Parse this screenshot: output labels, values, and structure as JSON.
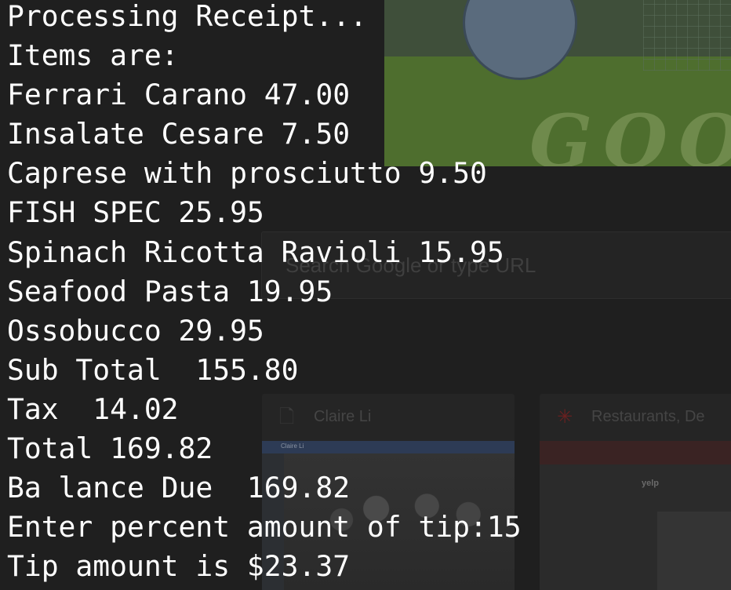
{
  "terminal": {
    "lines": [
      "Processing Receipt...",
      "Items are:",
      "Ferrari Carano 47.00",
      "Insalate Cesare 7.50",
      "Caprese with prosciutto 9.50",
      "FISH SPEC 25.95",
      "Spinach Ricotta Ravioli 15.95",
      "Seafood Pasta 19.95",
      "Ossobucco 29.95",
      "Sub Total  155.80",
      "Tax  14.02",
      "Total 169.82",
      "Ba lance Due  169.82",
      "Enter percent amount of tip:15",
      "Tip amount is $23.37"
    ]
  },
  "background_page": {
    "search": {
      "placeholder": "Search Google or type URL"
    },
    "tiles": [
      {
        "title": "Claire Li",
        "icon": "page-icon"
      },
      {
        "title": "Restaurants, De",
        "icon": "yelp-icon"
      }
    ],
    "doodle_text": "GOO",
    "facebook_thumb_text": "Claire Li",
    "yelp_thumb_text": "yelp"
  },
  "colors": {
    "terminal_text": "#ffffff",
    "background": "#1f1f1f"
  }
}
